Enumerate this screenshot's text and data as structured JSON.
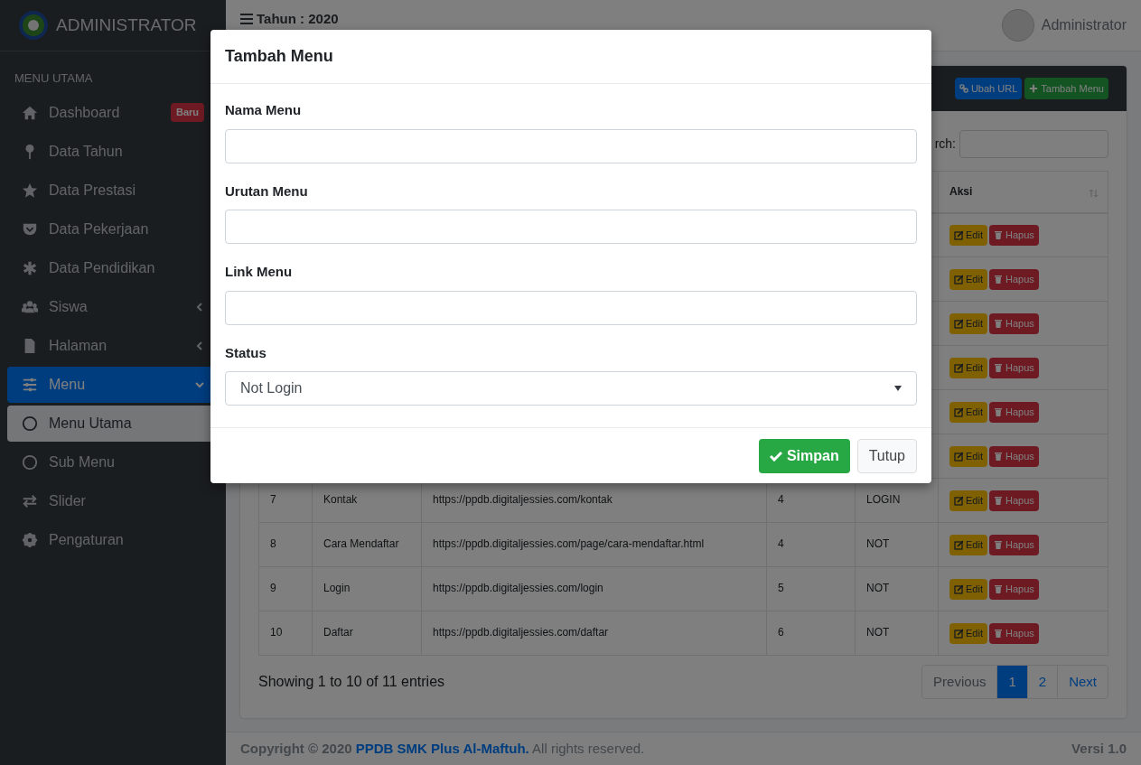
{
  "sidebar": {
    "brand": "ADMINISTRATOR",
    "section": "MENU UTAMA",
    "items": [
      {
        "label": "Dashboard",
        "badge": "Baru",
        "selected": false
      },
      {
        "label": "Data Tahun",
        "selected": false
      },
      {
        "label": "Data Prestasi",
        "selected": false
      },
      {
        "label": "Data Pekerjaan",
        "selected": false
      },
      {
        "label": "Data Pendidikan",
        "selected": false
      },
      {
        "label": "Siswa",
        "expanded": false,
        "selected": false
      },
      {
        "label": "Halaman",
        "expanded": false,
        "selected": false
      },
      {
        "label": "Menu",
        "expanded": true,
        "selected": true,
        "children": [
          {
            "label": "Menu Utama",
            "selected": true
          },
          {
            "label": "Sub Menu",
            "selected": false
          }
        ]
      },
      {
        "label": "Slider",
        "selected": false
      },
      {
        "label": "Pengaturan",
        "selected": false
      }
    ]
  },
  "header": {
    "year_label": "Tahun : 2020",
    "user": "Administrator"
  },
  "card": {
    "buttons": [
      {
        "label": "Ubah URL",
        "kind": "link"
      },
      {
        "label": "Tambah Menu",
        "kind": "add"
      }
    ],
    "search_label": "rch:",
    "table": {
      "action_header": "Aksi",
      "rows": [
        {
          "actions": [
            {
              "label": "Edit",
              "kind": "edit"
            },
            {
              "label": "Hapus",
              "kind": "delete"
            }
          ]
        },
        {
          "actions": [
            {
              "label": "Edit",
              "kind": "edit"
            },
            {
              "label": "Hapus",
              "kind": "delete"
            }
          ]
        },
        {
          "actions": [
            {
              "label": "Edit",
              "kind": "edit"
            },
            {
              "label": "Hapus",
              "kind": "delete"
            }
          ]
        },
        {
          "actions": [
            {
              "label": "Edit",
              "kind": "edit"
            },
            {
              "label": "Hapus",
              "kind": "delete"
            }
          ]
        },
        {
          "actions": [
            {
              "label": "Edit",
              "kind": "edit"
            },
            {
              "label": "Hapus",
              "kind": "delete"
            }
          ]
        },
        {
          "actions": [
            {
              "label": "Edit",
              "kind": "edit"
            },
            {
              "label": "Hapus",
              "kind": "delete"
            }
          ]
        },
        {
          "cells": [
            "7",
            "Kontak",
            "https://ppdb.digitaljessies.com/kontak",
            "4",
            "LOGIN"
          ],
          "actions": [
            {
              "label": "Edit",
              "kind": "edit"
            },
            {
              "label": "Hapus",
              "kind": "delete"
            }
          ]
        },
        {
          "cells": [
            "8",
            "Cara Mendaftar",
            "https://ppdb.digitaljessies.com/page/cara-mendaftar.html",
            "4",
            "NOT"
          ],
          "actions": [
            {
              "label": "Edit",
              "kind": "edit"
            },
            {
              "label": "Hapus",
              "kind": "delete"
            }
          ]
        },
        {
          "cells": [
            "9",
            "Login",
            "https://ppdb.digitaljessies.com/login",
            "5",
            "NOT"
          ],
          "actions": [
            {
              "label": "Edit",
              "kind": "edit"
            },
            {
              "label": "Hapus",
              "kind": "delete"
            }
          ]
        },
        {
          "cells": [
            "10",
            "Daftar",
            "https://ppdb.digitaljessies.com/daftar",
            "6",
            "NOT"
          ],
          "actions": [
            {
              "label": "Edit",
              "kind": "edit"
            },
            {
              "label": "Hapus",
              "kind": "delete"
            }
          ]
        }
      ]
    },
    "info": "Showing 1 to 10 of 11 entries",
    "pagination": [
      {
        "label": "Previous",
        "selected": false,
        "disabled": true
      },
      {
        "label": "1",
        "selected": true,
        "disabled": false
      },
      {
        "label": "2",
        "selected": false,
        "disabled": false
      },
      {
        "label": "Next",
        "selected": false,
        "disabled": false
      }
    ]
  },
  "footer": {
    "prefix": "Copyright © 2020",
    "link": "PPDB SMK Plus Al-Maftuh.",
    "suffix": "All rights reserved.",
    "version": "Versi 1.0"
  },
  "modal": {
    "title": "Tambah Menu",
    "fields": [
      {
        "label": "Nama Menu",
        "kind": "text"
      },
      {
        "label": "Urutan Menu",
        "kind": "text"
      },
      {
        "label": "Link Menu",
        "kind": "text"
      },
      {
        "label": "Status",
        "kind": "select",
        "value": "Not Login"
      }
    ],
    "buttons": [
      {
        "label": "Simpan",
        "kind": "primary"
      },
      {
        "label": "Tutup",
        "kind": "secondary"
      }
    ]
  }
}
